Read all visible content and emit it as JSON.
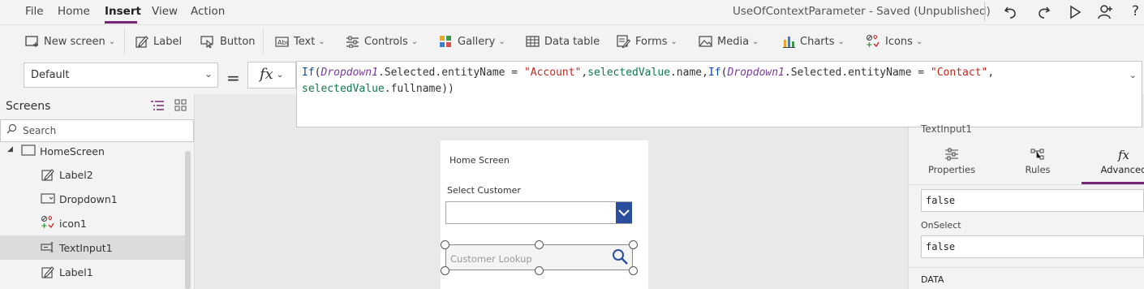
{
  "menubar": {
    "items": [
      "File",
      "Home",
      "Insert",
      "View",
      "Action"
    ],
    "active": "Insert",
    "doc_title": "UseOfContextParameter - Saved (Unpublished)"
  },
  "ribbon": {
    "new_screen": "New screen",
    "label": "Label",
    "button": "Button",
    "text": "Text",
    "controls": "Controls",
    "gallery": "Gallery",
    "data_table": "Data table",
    "forms": "Forms",
    "media": "Media",
    "charts": "Charts",
    "icons": "Icons"
  },
  "formula_bar": {
    "property": "Default",
    "equals": "=",
    "fx": "fx",
    "formula_line1": "If(Dropdown1.Selected.entityName = \"Account\",selectedValue.name,If(Dropdown1.Selected.entityName = \"Contact\",",
    "formula_line2": "selectedValue.fullname))"
  },
  "tree": {
    "title": "Screens",
    "search_placeholder": "Search",
    "screen": "HomeScreen",
    "items": [
      "Label2",
      "Dropdown1",
      "icon1",
      "TextInput1",
      "Label1"
    ],
    "selected": "TextInput1"
  },
  "canvas": {
    "home_title": "Home Screen",
    "select_customer": "Select Customer",
    "lookup_placeholder": "Customer Lookup"
  },
  "properties": {
    "control_name": "TextInput1",
    "tabs": [
      "Properties",
      "Rules",
      "Advanced"
    ],
    "active_tab": "Advanced",
    "value1": "false",
    "onselect_label": "OnSelect",
    "onselect_value": "false",
    "section": "DATA"
  },
  "colors": {
    "accent": "#742774",
    "dropdown_button": "#2b4d9e"
  }
}
